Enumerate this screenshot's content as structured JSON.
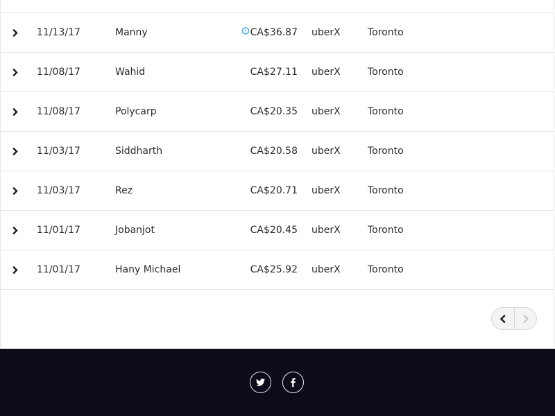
{
  "trips": [
    {
      "date": "11/13/17",
      "driver": "Manny",
      "fare": "CA$36.87",
      "car": "uberX",
      "city": "Toronto",
      "surge": true
    },
    {
      "date": "11/08/17",
      "driver": "Wahid",
      "fare": "CA$27.11",
      "car": "uberX",
      "city": "Toronto",
      "surge": false
    },
    {
      "date": "11/08/17",
      "driver": "Polycarp",
      "fare": "CA$20.35",
      "car": "uberX",
      "city": "Toronto",
      "surge": false
    },
    {
      "date": "11/03/17",
      "driver": "Siddharth",
      "fare": "CA$20.58",
      "car": "uberX",
      "city": "Toronto",
      "surge": false
    },
    {
      "date": "11/03/17",
      "driver": "Rez",
      "fare": "CA$20.71",
      "car": "uberX",
      "city": "Toronto",
      "surge": false
    },
    {
      "date": "11/01/17",
      "driver": "Jobanjot",
      "fare": "CA$20.45",
      "car": "uberX",
      "city": "Toronto",
      "surge": false
    },
    {
      "date": "11/01/17",
      "driver": "Hany Michael",
      "fare": "CA$25.92",
      "car": "uberX",
      "city": "Toronto",
      "surge": false
    }
  ],
  "icons": {
    "row_expand": "chevron-right-icon",
    "surge": "surge-icon",
    "prev": "chevron-left-icon",
    "next": "chevron-right-icon",
    "twitter": "twitter-icon",
    "facebook": "facebook-icon"
  },
  "pagination": {
    "prev_enabled": true,
    "next_enabled": false
  },
  "colors": {
    "footer_bg": "#0b0b19",
    "surge_icon": "#1fa1e0",
    "text": "#2b2b2b",
    "divider": "#e6e6e6"
  }
}
